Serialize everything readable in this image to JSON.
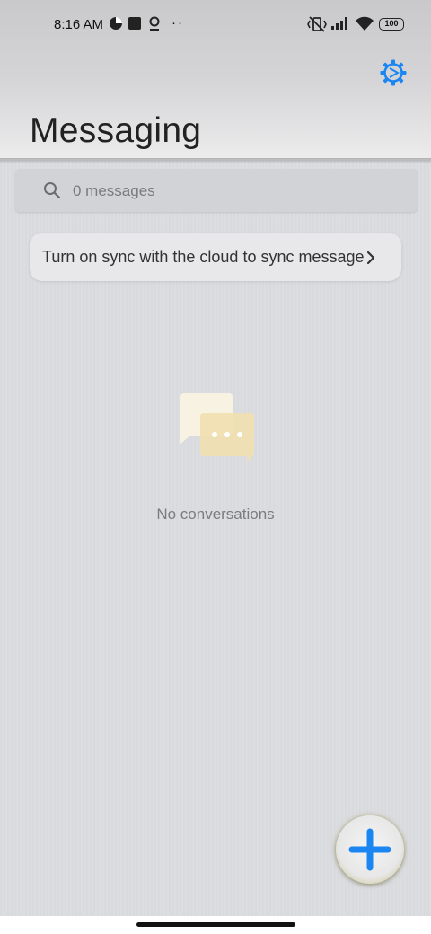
{
  "status_bar": {
    "time": "8:16 AM",
    "battery": "100"
  },
  "header": {
    "title": "Messaging",
    "settings_icon": "gear-icon",
    "accent_color": "#1b86f2"
  },
  "search": {
    "placeholder": "0 messages"
  },
  "sync_banner": {
    "text": "Turn on sync with the cloud to sync messages"
  },
  "empty_state": {
    "text": "No conversations"
  },
  "fab": {
    "icon": "plus-icon",
    "color": "#1b86f2"
  }
}
